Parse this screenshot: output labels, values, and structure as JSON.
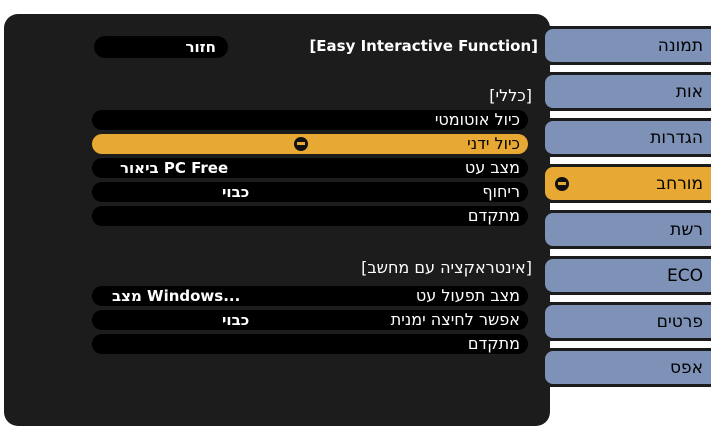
{
  "header": {
    "back_label": "חזור",
    "function_title": "[Easy Interactive Function]"
  },
  "sections": {
    "general": "[כללי]",
    "pc_interaction": "[אינטראקציה עם מחשב]"
  },
  "rows": [
    {
      "label": "כיול אוטומטי",
      "value": ""
    },
    {
      "label": "כיול ידני",
      "value": ""
    },
    {
      "label": "מצב עט",
      "value": "ביאור PC Free"
    },
    {
      "label": "ריחוף",
      "value": "כבוי"
    },
    {
      "label": "מתקדם",
      "value": ""
    },
    {
      "label": "מצב תפעול עט",
      "value": "מצב Windows..."
    },
    {
      "label": "אפשר לחיצה ימנית",
      "value": "כבוי"
    },
    {
      "label": "מתקדם",
      "value": ""
    }
  ],
  "tabs": [
    {
      "label": "תמונה"
    },
    {
      "label": "אות"
    },
    {
      "label": "הגדרות"
    },
    {
      "label": "מורחב"
    },
    {
      "label": "רשת"
    },
    {
      "label": "ECO"
    },
    {
      "label": "פרטים"
    },
    {
      "label": "אפס"
    }
  ],
  "colors": {
    "panel": "#1c1c1c",
    "tab": "#7e92b7",
    "accent": "#e8a934"
  },
  "icons": {
    "enter": "enter-icon"
  }
}
